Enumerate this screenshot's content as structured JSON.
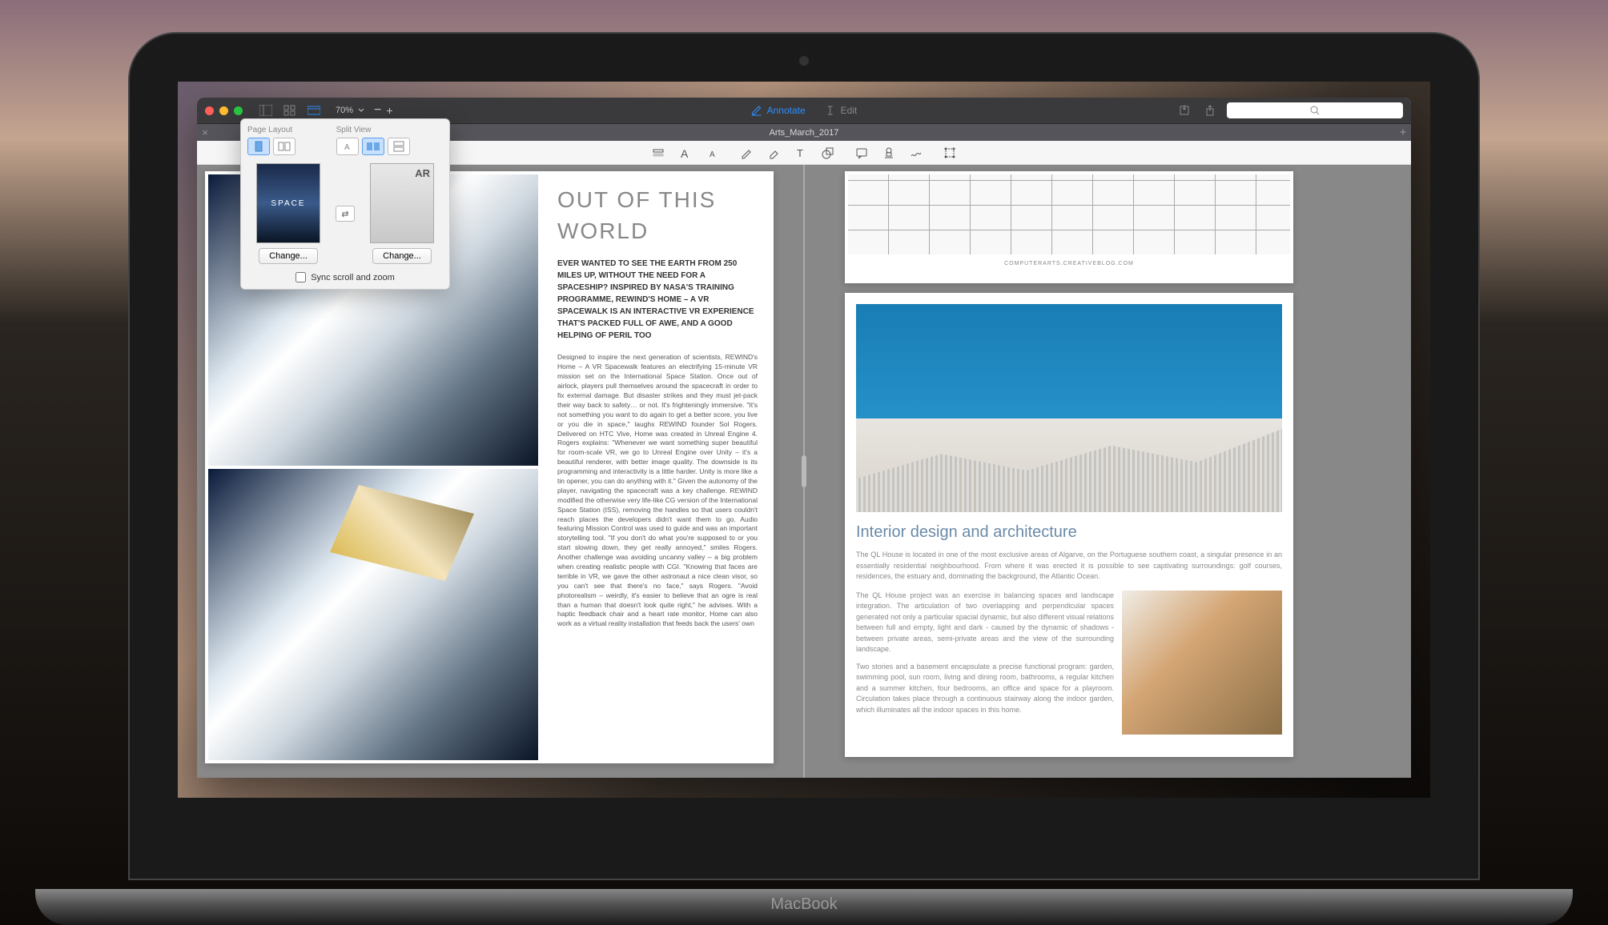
{
  "window": {
    "tab_title": "Arts_March_2017",
    "zoom_level": "70%"
  },
  "titlebar": {
    "annotate_label": "Annotate",
    "edit_label": "Edit"
  },
  "popover": {
    "page_layout_label": "Page Layout",
    "split_view_label": "Split View",
    "thumb_left_label": "SPACE",
    "thumb_right_label": "AR",
    "change_left": "Change...",
    "change_right": "Change...",
    "sync_label": "Sync scroll and zoom"
  },
  "left_article": {
    "title": "OUT OF THIS WORLD",
    "intro": "EVER WANTED TO SEE THE EARTH FROM 250 MILES UP, WITHOUT THE NEED FOR A SPACESHIP? INSPIRED BY NASA'S TRAINING PROGRAMME, REWIND'S HOME – A VR SPACEWALK IS AN INTERACTIVE VR EXPERIENCE THAT'S PACKED FULL OF AWE, AND A GOOD HELPING OF PERIL TOO",
    "body": "Designed to inspire the next generation of scientists, REWIND's Home – A VR Spacewalk features an electrifying 15-minute VR mission set on the International Space Station. Once out of airlock, players pull themselves around the spacecraft in order to fix external damage. But disaster strikes and they must jet-pack their way back to safety… or not. It's frighteningly immersive. \"It's not something you want to do again to get a better score, you live or you die in space,\" laughs REWIND founder Sol Rogers. Delivered on HTC Vive, Home was created in Unreal Engine 4. Rogers explains: \"Whenever we want something super beautiful for room-scale VR, we go to Unreal Engine over Unity – it's a beautiful renderer, with better image quality. The downside is its programming and interactivity is a little harder. Unity is more like a tin opener, you can do anything with it.\" Given the autonomy of the player, navigating the spacecraft was a key challenge. REWIND modified the otherwise very life-like CG version of the International Space Station (ISS), removing the handles so that users couldn't reach places the developers didn't want them to go. Audio featuring Mission Control was used to guide and was an important storytelling tool. \"If you don't do what you're supposed to or you start slowing down, they get really annoyed,\" smiles Rogers. Another challenge was avoiding uncanny valley – a big problem when creating realistic people with CGI. \"Knowing that faces are terrible in VR, we gave the other astronaut a nice clean visor, so you can't see that there's no face,\" says Rogers. \"Avoid photorealism – weirdly, it's easier to believe that an ogre is real than a human that doesn't look quite right,\" he advises. With a haptic feedback chair and a heart rate monitor, Home can also work as a virtual reality installation that feeds back the users' own"
  },
  "right_article": {
    "url_line": "COMPUTERARTS.CREATIVEBLOG.COM",
    "title": "Interior design and architecture",
    "para1": "The QL House is located in one of the most exclusive areas of Algarve, on the Portuguese southern coast, a singular presence in an essentially residential neighbourhood. From where it was erected it is possible to see captivating surroundings: golf courses, residences, the estuary and, dominating the background, the Atlantic Ocean.",
    "para2": "The QL House project was an exercise in balancing spaces and landscape integration. The articulation of two overlapping and perpendicular spaces generated not only a particular spacial dynamic, but also different visual relations between full and empty, light and dark - caused by the dynamic of shadows - between private areas, semi-private areas and the view of the surrounding landscape.",
    "para3": "Two stories and a basement encapsulate a precise functional program: garden, swimming pool, sun room, living and dining room, bathrooms, a regular kitchen and a summer kitchen, four bedrooms, an office and space for a playroom. Circulation takes place through a continuous stairway along the indoor garden, which illuminates all the indoor spaces in this home."
  },
  "brand": "MacBook"
}
